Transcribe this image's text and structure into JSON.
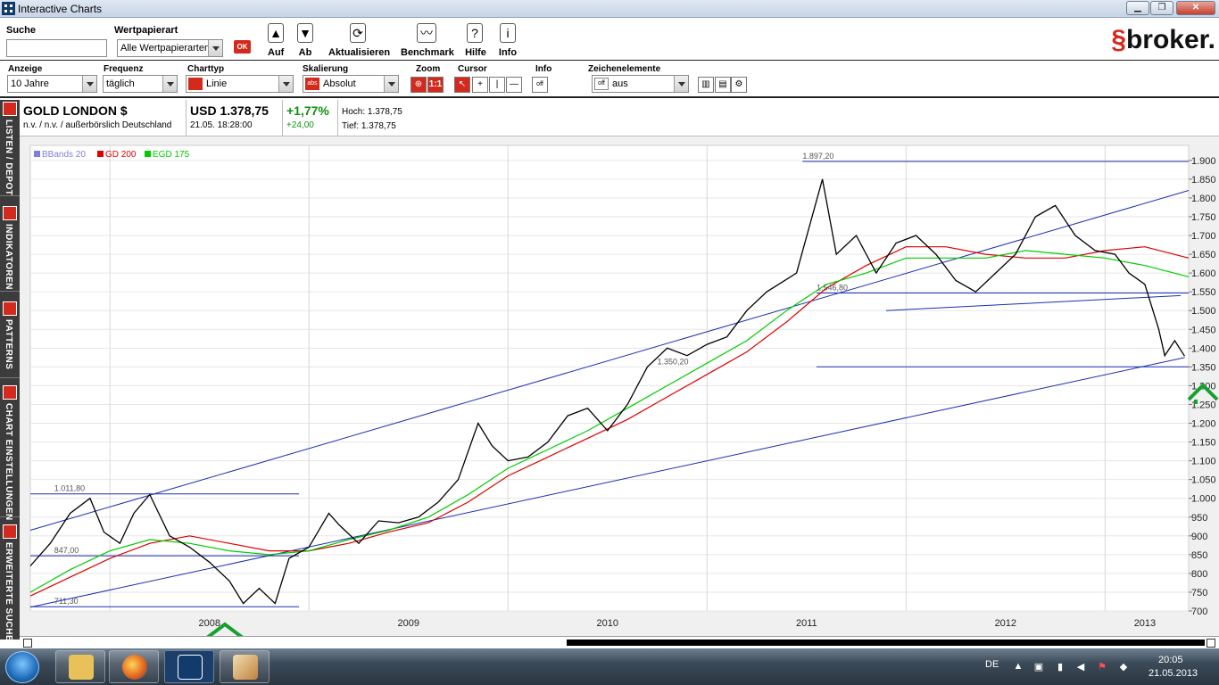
{
  "window": {
    "title": "Interactive Charts",
    "min": "▁",
    "max": "❐",
    "close": "✕"
  },
  "toolbar": {
    "search_label": "Suche",
    "search_value": "",
    "sectype_label": "Wertpapierart",
    "sectype_value": "Alle Wertpapierarten",
    "ok": "OK",
    "up_label": "Auf",
    "down_label": "Ab",
    "refresh_label": "Aktualisieren",
    "benchmark_label": "Benchmark",
    "help_label": "Hilfe",
    "info_label": "Info",
    "brand_s": "$",
    "brand_text": "broker."
  },
  "settings": {
    "anzeige_label": "Anzeige",
    "anzeige_value": "10 Jahre",
    "frequenz_label": "Frequenz",
    "frequenz_value": "täglich",
    "charttyp_label": "Charttyp",
    "charttyp_value": "Linie",
    "skalierung_label": "Skalierung",
    "skalierung_value": "Absolut",
    "skalierung_tag": "abs",
    "zoom_label": "Zoom",
    "zoom_value": "1:1",
    "cursor_label": "Cursor",
    "info_label": "Info",
    "info_value": "off",
    "zeichen_label": "Zeichenelemente",
    "zeichen_value": "aus",
    "zeichen_tag": "off"
  },
  "instrument": {
    "name": "GOLD LONDON $",
    "sub": "n.v. / n.v. / außerbörslich Deutschland",
    "price": "USD 1.378,75",
    "time": "21.05. 18:28:00",
    "change_pct": "+1,77%",
    "change_abs": "+24,00",
    "high": "Hoch: 1.378,75",
    "low": "Tief: 1.378,75"
  },
  "sidebar": {
    "tabs": [
      "LISTEN / DEPOT",
      "INDIKATOREN",
      "PATTERNS",
      "CHART EINSTELLUNGEN",
      "ERWEITERTE SUCHE"
    ]
  },
  "chart_data": {
    "type": "line",
    "legend": [
      {
        "name": "BBands 20",
        "color": "#7f7fe0"
      },
      {
        "name": "GD 200",
        "color": "#dd0000"
      },
      {
        "name": "EGD 175",
        "color": "#00cc00"
      }
    ],
    "x_tick_labels": [
      "2008",
      "2009",
      "2010",
      "2011",
      "2012",
      "2013"
    ],
    "y_tick_labels": [
      "1.900",
      "1.850",
      "1.800",
      "1.750",
      "1.700",
      "1.650",
      "1.600",
      "1.550",
      "1.500",
      "1.450",
      "1.400",
      "1.350",
      "1.300",
      "1.250",
      "1.200",
      "1.150",
      "1.100",
      "1.050",
      "1.000",
      "950",
      "900",
      "850",
      "800",
      "750",
      "700"
    ],
    "ylim": [
      700,
      1940
    ],
    "xlim": [
      2007.6,
      2013.42
    ],
    "annotations": [
      {
        "text": "1.897,20",
        "y": 1897.2
      },
      {
        "text": "1.546,80",
        "y": 1546.8
      },
      {
        "text": "1.350,20",
        "y": 1350.2
      },
      {
        "text": "1.011,80",
        "y": 1011.8
      },
      {
        "text": "847,00",
        "y": 847.0
      },
      {
        "text": "711,30",
        "y": 711.3
      }
    ],
    "series": [
      {
        "name": "GOLD LONDON $",
        "color": "#000000",
        "points": [
          [
            2007.6,
            820
          ],
          [
            2007.7,
            880
          ],
          [
            2007.8,
            960
          ],
          [
            2007.9,
            1000
          ],
          [
            2007.97,
            910
          ],
          [
            2008.05,
            880
          ],
          [
            2008.12,
            960
          ],
          [
            2008.2,
            1010
          ],
          [
            2008.3,
            900
          ],
          [
            2008.4,
            870
          ],
          [
            2008.5,
            830
          ],
          [
            2008.6,
            780
          ],
          [
            2008.67,
            720
          ],
          [
            2008.75,
            760
          ],
          [
            2008.83,
            720
          ],
          [
            2008.9,
            840
          ],
          [
            2009.0,
            870
          ],
          [
            2009.1,
            960
          ],
          [
            2009.15,
            930
          ],
          [
            2009.25,
            880
          ],
          [
            2009.35,
            940
          ],
          [
            2009.45,
            935
          ],
          [
            2009.55,
            950
          ],
          [
            2009.65,
            990
          ],
          [
            2009.75,
            1050
          ],
          [
            2009.85,
            1200
          ],
          [
            2009.92,
            1140
          ],
          [
            2010.0,
            1100
          ],
          [
            2010.1,
            1110
          ],
          [
            2010.2,
            1150
          ],
          [
            2010.3,
            1220
          ],
          [
            2010.4,
            1240
          ],
          [
            2010.5,
            1180
          ],
          [
            2010.6,
            1250
          ],
          [
            2010.7,
            1350
          ],
          [
            2010.8,
            1400
          ],
          [
            2010.9,
            1380
          ],
          [
            2011.0,
            1410
          ],
          [
            2011.1,
            1430
          ],
          [
            2011.2,
            1500
          ],
          [
            2011.3,
            1550
          ],
          [
            2011.45,
            1600
          ],
          [
            2011.58,
            1850
          ],
          [
            2011.65,
            1650
          ],
          [
            2011.75,
            1700
          ],
          [
            2011.85,
            1600
          ],
          [
            2011.95,
            1680
          ],
          [
            2012.05,
            1700
          ],
          [
            2012.15,
            1650
          ],
          [
            2012.25,
            1580
          ],
          [
            2012.35,
            1550
          ],
          [
            2012.45,
            1600
          ],
          [
            2012.55,
            1650
          ],
          [
            2012.65,
            1750
          ],
          [
            2012.75,
            1780
          ],
          [
            2012.85,
            1700
          ],
          [
            2012.95,
            1660
          ],
          [
            2013.05,
            1650
          ],
          [
            2013.12,
            1600
          ],
          [
            2013.2,
            1570
          ],
          [
            2013.27,
            1450
          ],
          [
            2013.3,
            1380
          ],
          [
            2013.35,
            1420
          ],
          [
            2013.4,
            1378.75
          ]
        ]
      },
      {
        "name": "GD 200",
        "color": "#dd0000",
        "points": [
          [
            2007.6,
            740
          ],
          [
            2007.8,
            790
          ],
          [
            2008.0,
            840
          ],
          [
            2008.2,
            880
          ],
          [
            2008.4,
            900
          ],
          [
            2008.6,
            880
          ],
          [
            2008.8,
            860
          ],
          [
            2009.0,
            860
          ],
          [
            2009.2,
            880
          ],
          [
            2009.4,
            910
          ],
          [
            2009.6,
            935
          ],
          [
            2009.8,
            990
          ],
          [
            2010.0,
            1060
          ],
          [
            2010.2,
            1110
          ],
          [
            2010.4,
            1160
          ],
          [
            2010.6,
            1210
          ],
          [
            2010.8,
            1270
          ],
          [
            2011.0,
            1330
          ],
          [
            2011.2,
            1390
          ],
          [
            2011.4,
            1470
          ],
          [
            2011.6,
            1560
          ],
          [
            2011.8,
            1620
          ],
          [
            2012.0,
            1670
          ],
          [
            2012.2,
            1670
          ],
          [
            2012.4,
            1650
          ],
          [
            2012.6,
            1640
          ],
          [
            2012.8,
            1640
          ],
          [
            2013.0,
            1660
          ],
          [
            2013.2,
            1670
          ],
          [
            2013.42,
            1640
          ]
        ]
      },
      {
        "name": "EGD 175",
        "color": "#00cc00",
        "points": [
          [
            2007.6,
            750
          ],
          [
            2007.8,
            810
          ],
          [
            2008.0,
            860
          ],
          [
            2008.2,
            890
          ],
          [
            2008.4,
            880
          ],
          [
            2008.6,
            860
          ],
          [
            2008.8,
            850
          ],
          [
            2009.0,
            860
          ],
          [
            2009.2,
            890
          ],
          [
            2009.4,
            915
          ],
          [
            2009.6,
            950
          ],
          [
            2009.8,
            1010
          ],
          [
            2010.0,
            1080
          ],
          [
            2010.2,
            1130
          ],
          [
            2010.4,
            1180
          ],
          [
            2010.6,
            1240
          ],
          [
            2010.8,
            1300
          ],
          [
            2011.0,
            1360
          ],
          [
            2011.2,
            1420
          ],
          [
            2011.4,
            1500
          ],
          [
            2011.6,
            1570
          ],
          [
            2011.8,
            1600
          ],
          [
            2012.0,
            1640
          ],
          [
            2012.2,
            1640
          ],
          [
            2012.4,
            1640
          ],
          [
            2012.6,
            1660
          ],
          [
            2012.8,
            1650
          ],
          [
            2013.0,
            1640
          ],
          [
            2013.2,
            1620
          ],
          [
            2013.42,
            1590
          ]
        ]
      }
    ]
  },
  "taskbar": {
    "lang": "DE",
    "time": "20:05",
    "date": "21.05.2013"
  }
}
